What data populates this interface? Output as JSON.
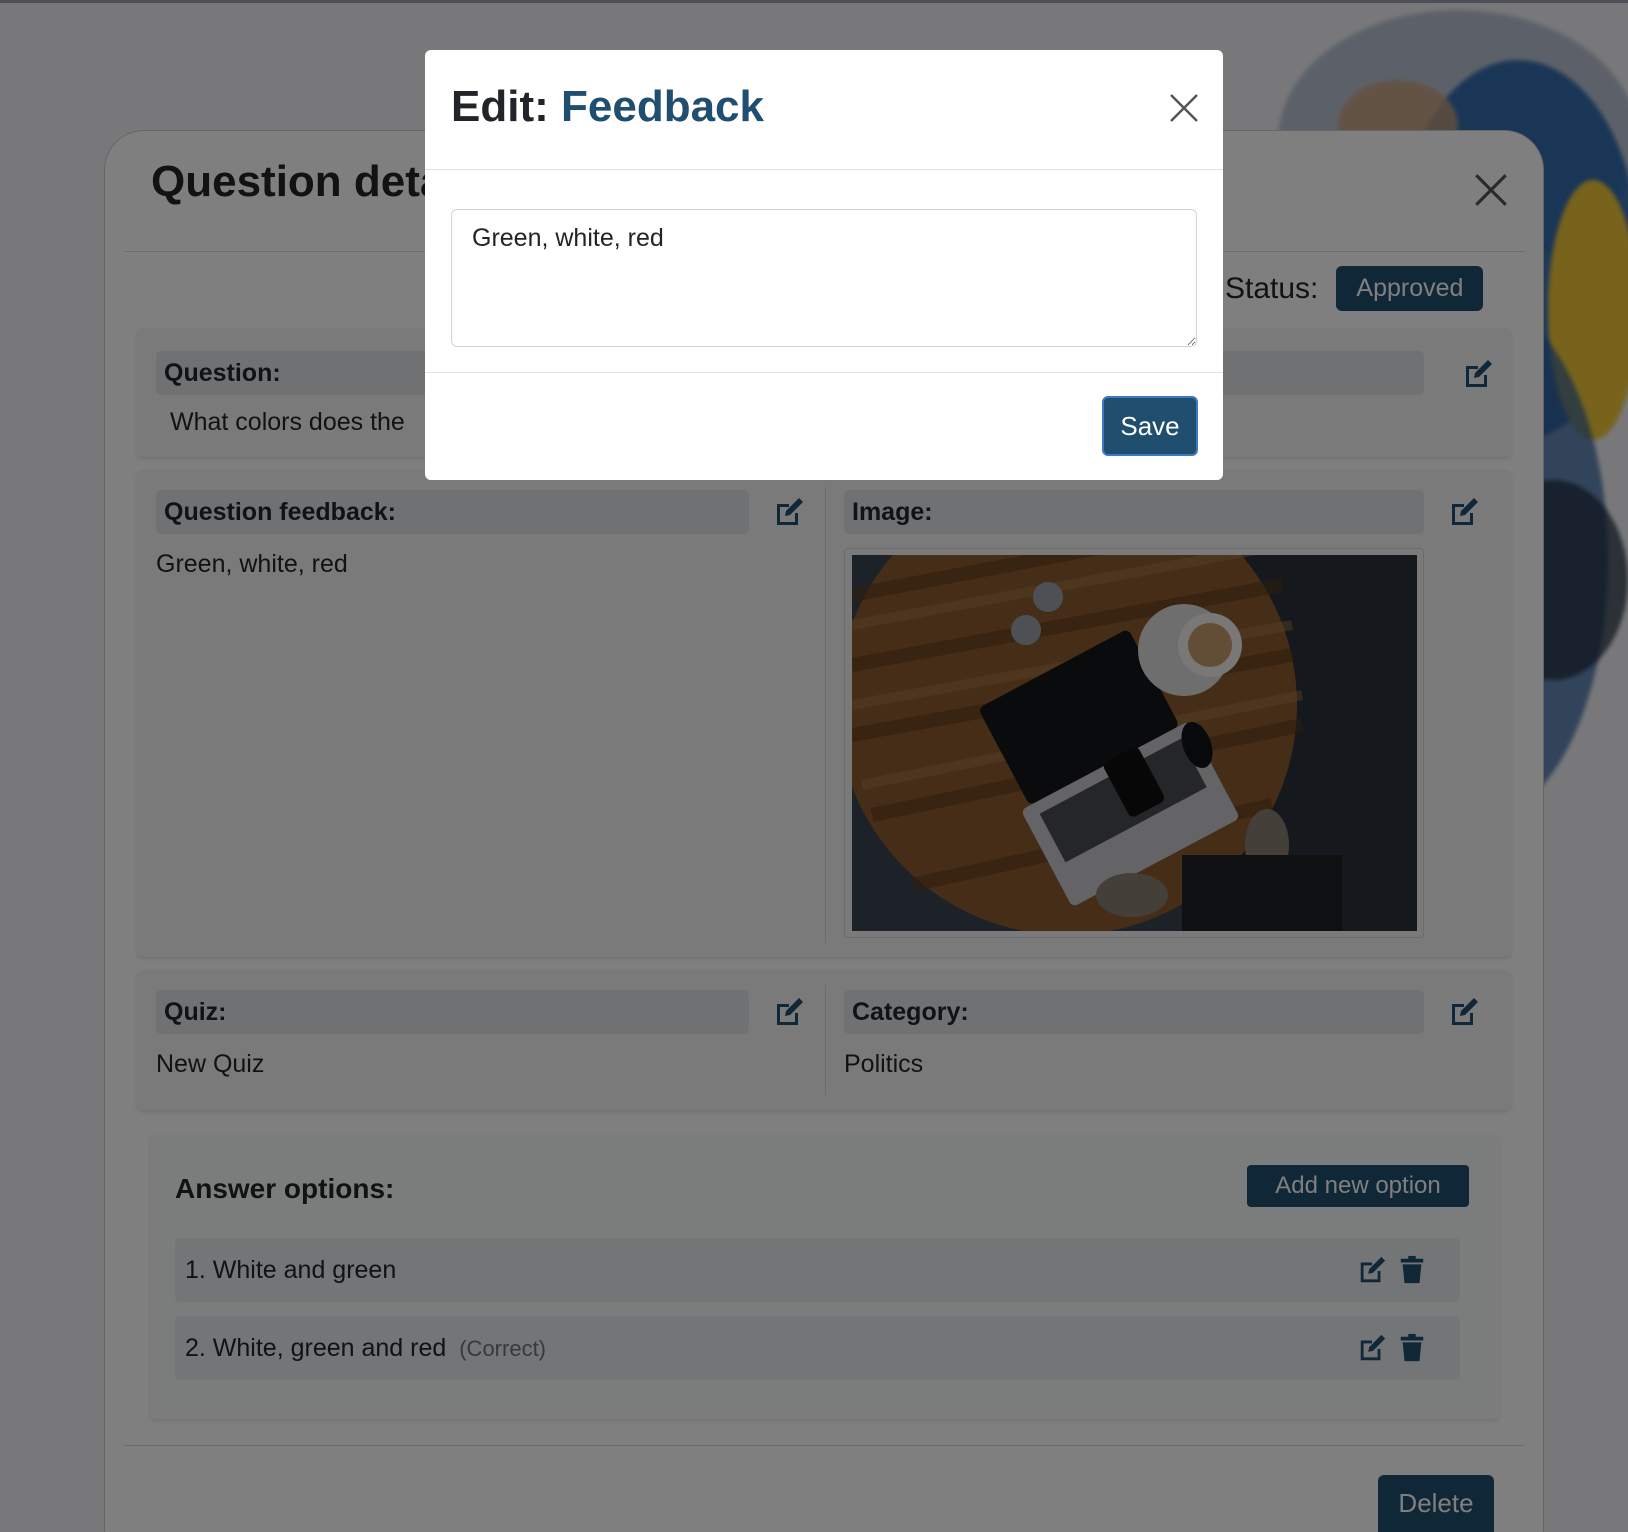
{
  "background": {
    "accent_color": "#1f4e6e"
  },
  "question_modal": {
    "title": "Question deta",
    "status_label": "Status:",
    "status_value": "Approved",
    "question": {
      "label": "Question:",
      "value": "What colors does the"
    },
    "feedback": {
      "label": "Question feedback:",
      "value": "Green, white, red"
    },
    "image": {
      "label": "Image:",
      "alt": "laptop-on-wooden-table-photo"
    },
    "quiz": {
      "label": "Quiz:",
      "value": "New Quiz"
    },
    "category": {
      "label": "Category:",
      "value": "Politics"
    },
    "answers": {
      "title": "Answer options:",
      "add_label": "Add new option",
      "items": [
        {
          "text": "1. White and green",
          "tag": ""
        },
        {
          "text": "2. White, green and red",
          "tag": "(Correct)"
        }
      ]
    },
    "delete_label": "Delete"
  },
  "edit_modal": {
    "title_prefix": "Edit:",
    "title_field": "Feedback",
    "textarea_value": "Green, white, red",
    "save_label": "Save"
  }
}
